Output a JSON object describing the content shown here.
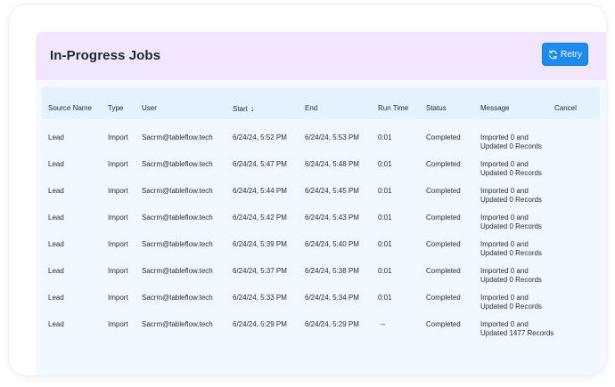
{
  "panel": {
    "title": "In-Progress Jobs",
    "retry_label": "Retry",
    "retry_icon": "refresh-icon"
  },
  "colors": {
    "header_bg": "#f1e6fd",
    "retry_button": "#1a8cf0",
    "table_header_bg": "#e4f1fe",
    "table_body_bg": "#f2f8ff"
  },
  "table": {
    "columns": {
      "source_name": "Source Name",
      "type": "Type",
      "user": "User",
      "start": "Start",
      "end": "End",
      "run_time": "Run Time",
      "status": "Status",
      "message": "Message",
      "cancel": "Cancel"
    },
    "sort_icon": "↓",
    "rows": [
      {
        "source": "Lead",
        "type": "Import",
        "user": "Sacrm@tableflow.tech",
        "start": "6/24/24, 5:52 PM",
        "end": "6/24/24, 5:53 PM",
        "runtime": "0:01",
        "status": "Completed",
        "msg1": "Imported 0 and",
        "msg2": "Updated 0 Records"
      },
      {
        "source": "Lead",
        "type": "Import",
        "user": "Sacrm@tableflow.tech",
        "start": "6/24/24, 5:47 PM",
        "end": "6/24/24, 5:48 PM",
        "runtime": "0:01",
        "status": "Completed",
        "msg1": "Imported 0 and",
        "msg2": "Updated 0 Records"
      },
      {
        "source": "Lead",
        "type": "Import",
        "user": "Sacrm@tableflow.tech",
        "start": "6/24/24, 5:44 PM",
        "end": "6/24/24, 5:45 PM",
        "runtime": "0:01",
        "status": "Completed",
        "msg1": "Imported 0 and",
        "msg2": "Updated 0 Records"
      },
      {
        "source": "Lead",
        "type": "Import",
        "user": "Sacrm@tableflow.tech",
        "start": "6/24/24, 5:42 PM",
        "end": "6/24/24, 5:43 PM",
        "runtime": "0:01",
        "status": "Completed",
        "msg1": "Imported 0 and",
        "msg2": "Updated 0 Records"
      },
      {
        "source": "Lead",
        "type": "Import",
        "user": "Sacrm@tableflow.tech",
        "start": "6/24/24, 5:39 PM",
        "end": "6/24/24, 5:40 PM",
        "runtime": "0:01",
        "status": "Completed",
        "msg1": "Imported 0 and",
        "msg2": "Updated 0 Records"
      },
      {
        "source": "Lead",
        "type": "Import",
        "user": "Sacrm@tableflow.tech",
        "start": "6/24/24, 5:37 PM",
        "end": "6/24/24, 5:38 PM",
        "runtime": "0:01",
        "status": "Completed",
        "msg1": "Imported 0 and",
        "msg2": "Updated 0 Records"
      },
      {
        "source": "Lead",
        "type": "Import",
        "user": "Sacrm@tableflow.tech",
        "start": "6/24/24, 5:33 PM",
        "end": "6/24/24, 5:34 PM",
        "runtime": "0:01",
        "status": "Completed",
        "msg1": "Imported 0 and",
        "msg2": "Updated 0 Records"
      },
      {
        "source": "Lead",
        "type": "Import",
        "user": "Sacrm@tableflow.tech",
        "start": "6/24/24, 5:29 PM",
        "end": "6/24/24, 5:29 PM",
        "runtime": "--",
        "status": "Completed",
        "msg1": "Imported 0 and",
        "msg2": "Updated 1477 Records"
      }
    ]
  }
}
